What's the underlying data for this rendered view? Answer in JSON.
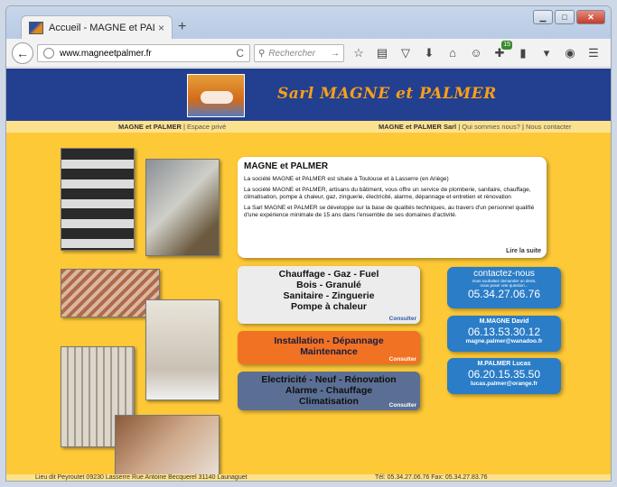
{
  "browser": {
    "tab_title": "Accueil - MAGNE et PALM...",
    "tab_close": "×",
    "new_tab": "+",
    "url_host": "www.magneetpalmer.fr",
    "search_placeholder": "Rechercher",
    "download_badge": "15"
  },
  "site": {
    "title": "Sarl MAGNE et PALMER",
    "subnav_left_brand": "MAGNE et PALMER",
    "subnav_left_link": "Espace privé",
    "subnav_right_brand": "MAGNE et PALMER Sarl",
    "subnav_right_link1": "Qui sommes nous?",
    "subnav_right_link2": "Nous contacter"
  },
  "info": {
    "title": "MAGNE et PALMER",
    "p1": "La société MAGNE et PALMER est située à Toulouse et à Lasserre (en Ariège)",
    "p2": "La société MAGNE et PALMER, artisans du bâtiment, vous offre un service de plomberie, sanitaire, chauffage, climatisation, pompe à chaleur, gaz, zinguerie, électricité, alarme, dépannage et entretien et rénovation",
    "p3": "La Sarl MAGNE et PALMER se développe sur la base de qualités techniques, au travers d'un personnel qualifié d'une expérience minimale de 15 ans dans l'ensemble de ses domaines d'activité.",
    "more": "Lire la suite"
  },
  "services": [
    {
      "lines": [
        "Chauffage - Gaz - Fuel",
        "Bois - Granulé",
        "Sanitaire - Zinguerie",
        "Pompe à chaleur"
      ],
      "link": "Consulter"
    },
    {
      "lines": [
        "Installation - Dépannage",
        "Maintenance"
      ],
      "link": "Consulter"
    },
    {
      "lines": [
        "Electricité - Neuf - Rénovation",
        "Alarme - Chauffage",
        "Climatisation"
      ],
      "link": "Consulter"
    }
  ],
  "contacts": {
    "main_title": "contactez-nous",
    "main_small1": "Vous souhaitez demander un devis,",
    "main_small2": "nous poser une question...",
    "main_phone": "05.34.27.06.76",
    "c2_name": "M.MAGNE David",
    "c2_phone": "06.13.53.30.12",
    "c2_email": "magne.palmer@wanadoo.fr",
    "c3_name": "M.PALMER Lucas",
    "c3_phone": "06.20.15.35.50",
    "c3_email": "lucas.palmer@orange.fr"
  },
  "footer": {
    "address": "Lieu dit Peyroutet 09230 Lasserre  Rue Antoine Becquerel 31140 Launaguet",
    "phones": "Tél: 05.34.27.06.76   Fax: 05.34.27.83.76"
  },
  "colors": {
    "page_bg": "#fec937",
    "header_bg": "#233f8f",
    "title": "#f7a019",
    "orange_service": "#f07222",
    "blue_service": "#5b6f95",
    "contact_blue": "#2b7dc7"
  }
}
